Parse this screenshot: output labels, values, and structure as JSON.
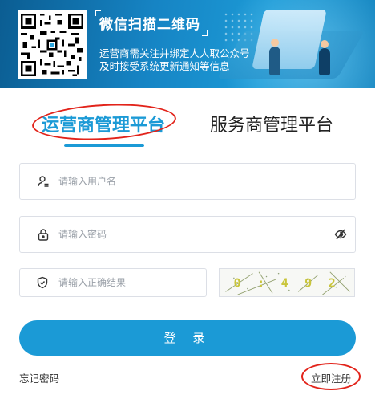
{
  "banner": {
    "title": "微信扫描二维码",
    "line1": "运营商需关注并绑定人人取公众号",
    "line2": "及时接受系统更新通知等信息"
  },
  "tabs": [
    {
      "label": "运营商管理平台",
      "active": true
    },
    {
      "label": "服务商管理平台",
      "active": false
    }
  ],
  "form": {
    "username_placeholder": "请输入用户名",
    "password_placeholder": "请输入密码",
    "captcha_placeholder": "请输入正确结果",
    "captcha_text": "0 : 4 9 2",
    "login_label": "登 录"
  },
  "links": {
    "forgot": "忘记密码",
    "register": "立即注册"
  },
  "colors": {
    "accent": "#1b9ad6",
    "annotation": "#e2231a",
    "banner": "#1684c4"
  }
}
